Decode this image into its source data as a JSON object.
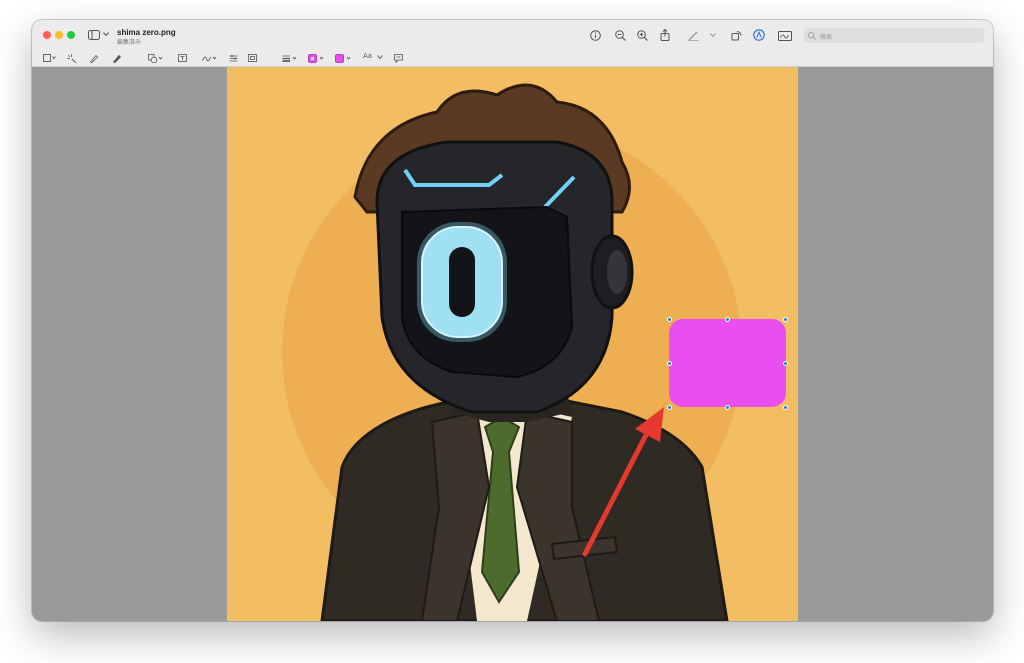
{
  "window": {
    "title": "shima zero.png",
    "subtitle": "編集済み"
  },
  "search": {
    "placeholder": "検索"
  },
  "toolbar": {
    "text_style_label": "Aa"
  },
  "colors": {
    "canvas_background": "#f2bd63",
    "rectangle_fill": "#e94ef0",
    "arrow": "#e5382f",
    "selection_handle": "#1e7be0"
  },
  "icons": [
    "sidebar-icon",
    "info-icon",
    "zoom-out-icon",
    "zoom-in-icon",
    "share-icon",
    "pen-icon",
    "rotate-icon",
    "markup-icon",
    "signature-icon",
    "search-icon"
  ]
}
